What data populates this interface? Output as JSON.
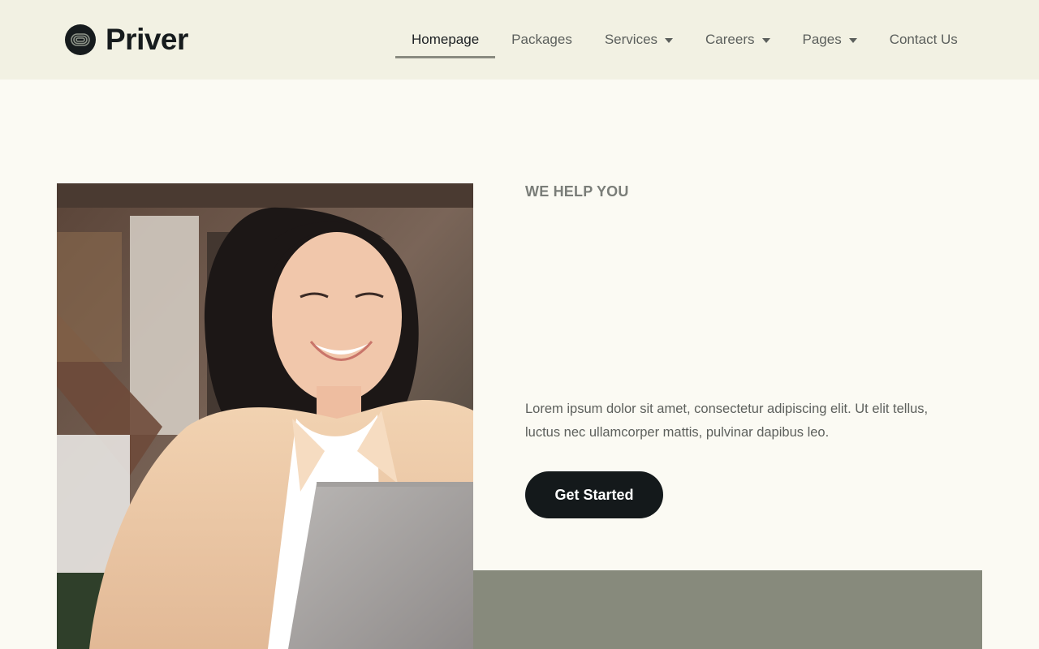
{
  "brand": {
    "name": "Priver",
    "logo_icon": "concentric-loop-logo-icon"
  },
  "nav": {
    "items": [
      {
        "label": "Homepage",
        "active": true
      },
      {
        "label": "Packages"
      },
      {
        "label": "Services",
        "dropdown": true
      },
      {
        "label": "Careers",
        "dropdown": true
      },
      {
        "label": "Pages",
        "dropdown": true
      },
      {
        "label": "Contact Us"
      }
    ],
    "dropdown_icon": "caret-down-icon"
  },
  "hero": {
    "kicker": "WE HELP YOU",
    "description": "Lorem ipsum dolor sit amet, consectetur adipiscing elit. Ut elit tellus, luctus nec ullamcorper mattis, pulvinar dapibus leo.",
    "cta_label": "Get Started",
    "photo": "smiling-woman-with-laptop-photo"
  },
  "colors": {
    "header_bg": "#f2f1e3",
    "page_bg": "#fbfaf3",
    "accent_dark": "#14191b",
    "accent_gray": "#878a7c"
  }
}
